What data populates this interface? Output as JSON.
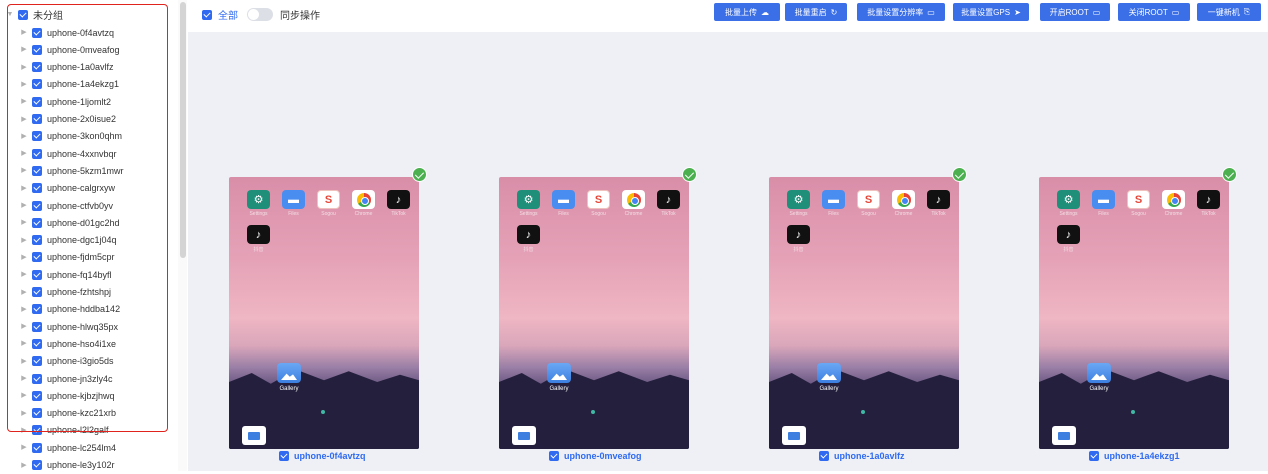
{
  "sidebar": {
    "root_label": "未分组",
    "items": [
      {
        "label": "uphone-0f4avtzq"
      },
      {
        "label": "uphone-0mveafog"
      },
      {
        "label": "uphone-1a0avlfz"
      },
      {
        "label": "uphone-1a4ekzg1"
      },
      {
        "label": "uphone-1ljomlt2"
      },
      {
        "label": "uphone-2x0isue2"
      },
      {
        "label": "uphone-3kon0qhm"
      },
      {
        "label": "uphone-4xxnvbqr"
      },
      {
        "label": "uphone-5kzm1mwr"
      },
      {
        "label": "uphone-calgrxyw"
      },
      {
        "label": "uphone-ctfvb0yv"
      },
      {
        "label": "uphone-d01gc2hd"
      },
      {
        "label": "uphone-dgc1j04q"
      },
      {
        "label": "uphone-fjdm5cpr"
      },
      {
        "label": "uphone-fq14byfl"
      },
      {
        "label": "uphone-fzhtshpj"
      },
      {
        "label": "uphone-hddba142"
      },
      {
        "label": "uphone-hlwq35px"
      },
      {
        "label": "uphone-hso4i1xe"
      },
      {
        "label": "uphone-i3gio5ds"
      },
      {
        "label": "uphone-jn3zly4c"
      },
      {
        "label": "uphone-kjbzjhwq"
      },
      {
        "label": "uphone-kzc21xrb"
      },
      {
        "label": "uphone-l2l2galf"
      },
      {
        "label": "uphone-lc254lm4"
      },
      {
        "label": "uphone-le3y102r"
      }
    ]
  },
  "toolbar": {
    "all_label": "全部",
    "sync_label": "同步操作",
    "buttons": [
      {
        "label": "批量上传",
        "icon": "☁"
      },
      {
        "label": "批量重启",
        "icon": "↻"
      },
      {
        "label": "批量设置分辨率",
        "icon": "▭"
      },
      {
        "label": "批量设置GPS",
        "icon": "➤"
      },
      {
        "label": "开启ROOT",
        "icon": "▭"
      },
      {
        "label": "关闭ROOT",
        "icon": "▭"
      },
      {
        "label": "一键新机",
        "icon": "⎘"
      }
    ]
  },
  "devices": [
    {
      "name": "uphone-0f4avtzq"
    },
    {
      "name": "uphone-0mveafog"
    },
    {
      "name": "uphone-1a0avlfz"
    },
    {
      "name": "uphone-1a4ekzg1"
    }
  ],
  "apps": [
    "Settings",
    "Files",
    "Sogou",
    "Chrome",
    "TikTok",
    "抖音"
  ],
  "gallery_label": "Gallery",
  "colors": {
    "accent": "#3b6fe8",
    "check": "#4caf50",
    "highlight": "#e0241d"
  }
}
